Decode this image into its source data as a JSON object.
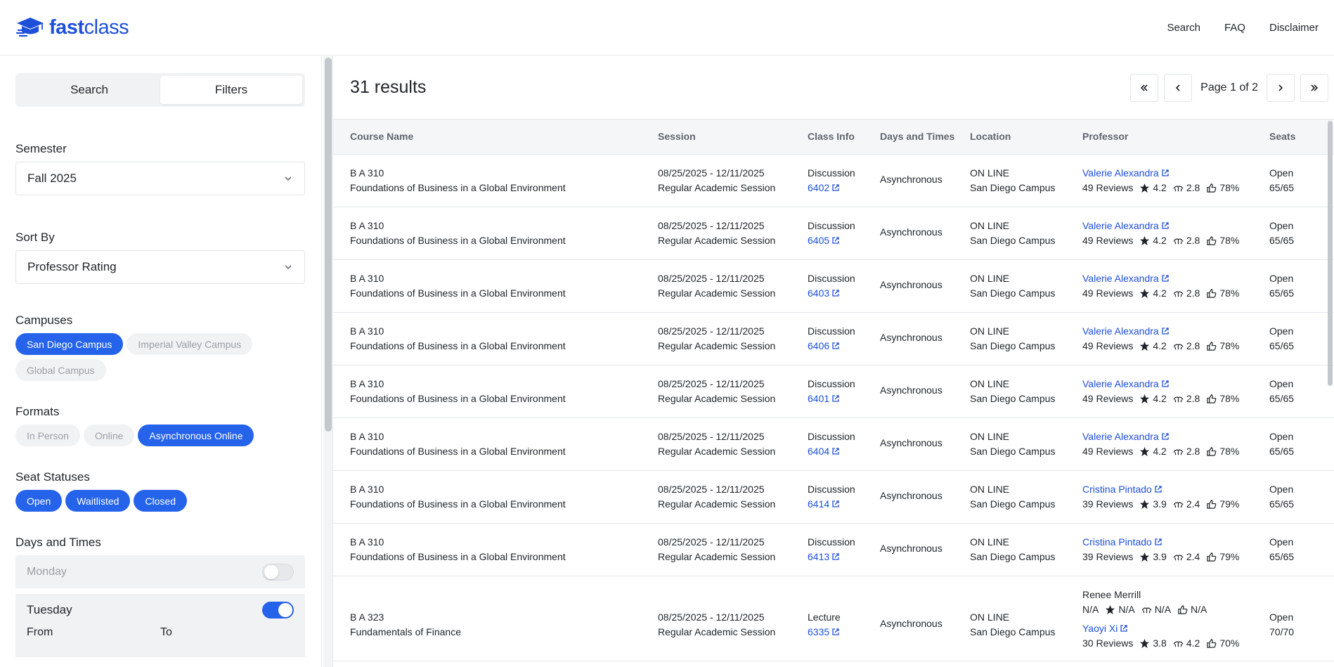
{
  "brand": {
    "name_bold": "fast",
    "name_light": "class",
    "color": "#1d4fd8"
  },
  "topnav": [
    "Search",
    "FAQ",
    "Disclaimer"
  ],
  "sidebar": {
    "tabs": [
      "Search",
      "Filters"
    ],
    "active_tab": "Filters",
    "semester": {
      "label": "Semester",
      "value": "Fall 2025"
    },
    "sort_by": {
      "label": "Sort By",
      "value": "Professor Rating"
    },
    "campuses": {
      "label": "Campuses",
      "options": [
        {
          "label": "San Diego Campus",
          "selected": true
        },
        {
          "label": "Imperial Valley Campus",
          "selected": false
        },
        {
          "label": "Global Campus",
          "selected": false
        }
      ]
    },
    "formats": {
      "label": "Formats",
      "options": [
        {
          "label": "In Person",
          "selected": false
        },
        {
          "label": "Online",
          "selected": false
        },
        {
          "label": "Asynchronous Online",
          "selected": true
        }
      ]
    },
    "seat_statuses": {
      "label": "Seat Statuses",
      "options": [
        {
          "label": "Open",
          "selected": true
        },
        {
          "label": "Waitlisted",
          "selected": true
        },
        {
          "label": "Closed",
          "selected": true
        }
      ]
    },
    "days_and_times": {
      "label": "Days and Times",
      "monday": {
        "label": "Monday",
        "enabled": false
      },
      "tuesday": {
        "label": "Tuesday",
        "enabled": true,
        "from_label": "From",
        "to_label": "To"
      }
    }
  },
  "results": {
    "count_text": "31 results",
    "page_text": "Page 1 of 2",
    "pager_icons": [
      "first-page-icon",
      "prev-page-icon",
      "next-page-icon",
      "last-page-icon"
    ],
    "columns": [
      "Course Name",
      "Session",
      "Class Info",
      "Days and Times",
      "Location",
      "Professor",
      "Seats"
    ],
    "rows": [
      {
        "code": "B A 310",
        "title": "Foundations of Business in a Global Environment",
        "dates": "08/25/2025 - 12/11/2025",
        "session": "Regular Academic Session",
        "type": "Discussion",
        "class_no": "6402",
        "days": "Asynchronous",
        "room": "ON LINE",
        "campus": "San Diego Campus",
        "professor": "Valerie Alexandra",
        "reviews": "49 Reviews",
        "rating": "4.2",
        "difficulty": "2.8",
        "again": "78%",
        "status": "Open",
        "seats": "65/65"
      },
      {
        "code": "B A 310",
        "title": "Foundations of Business in a Global Environment",
        "dates": "08/25/2025 - 12/11/2025",
        "session": "Regular Academic Session",
        "type": "Discussion",
        "class_no": "6405",
        "days": "Asynchronous",
        "room": "ON LINE",
        "campus": "San Diego Campus",
        "professor": "Valerie Alexandra",
        "reviews": "49 Reviews",
        "rating": "4.2",
        "difficulty": "2.8",
        "again": "78%",
        "status": "Open",
        "seats": "65/65"
      },
      {
        "code": "B A 310",
        "title": "Foundations of Business in a Global Environment",
        "dates": "08/25/2025 - 12/11/2025",
        "session": "Regular Academic Session",
        "type": "Discussion",
        "class_no": "6403",
        "days": "Asynchronous",
        "room": "ON LINE",
        "campus": "San Diego Campus",
        "professor": "Valerie Alexandra",
        "reviews": "49 Reviews",
        "rating": "4.2",
        "difficulty": "2.8",
        "again": "78%",
        "status": "Open",
        "seats": "65/65"
      },
      {
        "code": "B A 310",
        "title": "Foundations of Business in a Global Environment",
        "dates": "08/25/2025 - 12/11/2025",
        "session": "Regular Academic Session",
        "type": "Discussion",
        "class_no": "6406",
        "days": "Asynchronous",
        "room": "ON LINE",
        "campus": "San Diego Campus",
        "professor": "Valerie Alexandra",
        "reviews": "49 Reviews",
        "rating": "4.2",
        "difficulty": "2.8",
        "again": "78%",
        "status": "Open",
        "seats": "65/65"
      },
      {
        "code": "B A 310",
        "title": "Foundations of Business in a Global Environment",
        "dates": "08/25/2025 - 12/11/2025",
        "session": "Regular Academic Session",
        "type": "Discussion",
        "class_no": "6401",
        "days": "Asynchronous",
        "room": "ON LINE",
        "campus": "San Diego Campus",
        "professor": "Valerie Alexandra",
        "reviews": "49 Reviews",
        "rating": "4.2",
        "difficulty": "2.8",
        "again": "78%",
        "status": "Open",
        "seats": "65/65"
      },
      {
        "code": "B A 310",
        "title": "Foundations of Business in a Global Environment",
        "dates": "08/25/2025 - 12/11/2025",
        "session": "Regular Academic Session",
        "type": "Discussion",
        "class_no": "6404",
        "days": "Asynchronous",
        "room": "ON LINE",
        "campus": "San Diego Campus",
        "professor": "Valerie Alexandra",
        "reviews": "49 Reviews",
        "rating": "4.2",
        "difficulty": "2.8",
        "again": "78%",
        "status": "Open",
        "seats": "65/65"
      },
      {
        "code": "B A 310",
        "title": "Foundations of Business in a Global Environment",
        "dates": "08/25/2025 - 12/11/2025",
        "session": "Regular Academic Session",
        "type": "Discussion",
        "class_no": "6414",
        "days": "Asynchronous",
        "room": "ON LINE",
        "campus": "San Diego Campus",
        "professor": "Cristina Pintado",
        "reviews": "39 Reviews",
        "rating": "3.9",
        "difficulty": "2.4",
        "again": "79%",
        "status": "Open",
        "seats": "65/65"
      },
      {
        "code": "B A 310",
        "title": "Foundations of Business in a Global Environment",
        "dates": "08/25/2025 - 12/11/2025",
        "session": "Regular Academic Session",
        "type": "Discussion",
        "class_no": "6413",
        "days": "Asynchronous",
        "room": "ON LINE",
        "campus": "San Diego Campus",
        "professor": "Cristina Pintado",
        "reviews": "39 Reviews",
        "rating": "3.9",
        "difficulty": "2.4",
        "again": "79%",
        "status": "Open",
        "seats": "65/65"
      }
    ],
    "last_row": {
      "code": "B A 323",
      "title": "Fundamentals of Finance",
      "dates": "08/25/2025 - 12/11/2025",
      "session": "Regular Academic Session",
      "type": "Lecture",
      "class_no": "6335",
      "days": "Asynchronous",
      "room": "ON LINE",
      "campus": "San Diego Campus",
      "prof1": {
        "name": "Renee Merrill",
        "reviews": "N/A",
        "rating": "N/A",
        "difficulty": "N/A",
        "again": "N/A"
      },
      "prof2": {
        "name": "Yaoyi Xi",
        "reviews": "30 Reviews",
        "rating": "3.8",
        "difficulty": "4.2",
        "again": "70%"
      },
      "status": "Open",
      "seats": "70/70"
    }
  }
}
